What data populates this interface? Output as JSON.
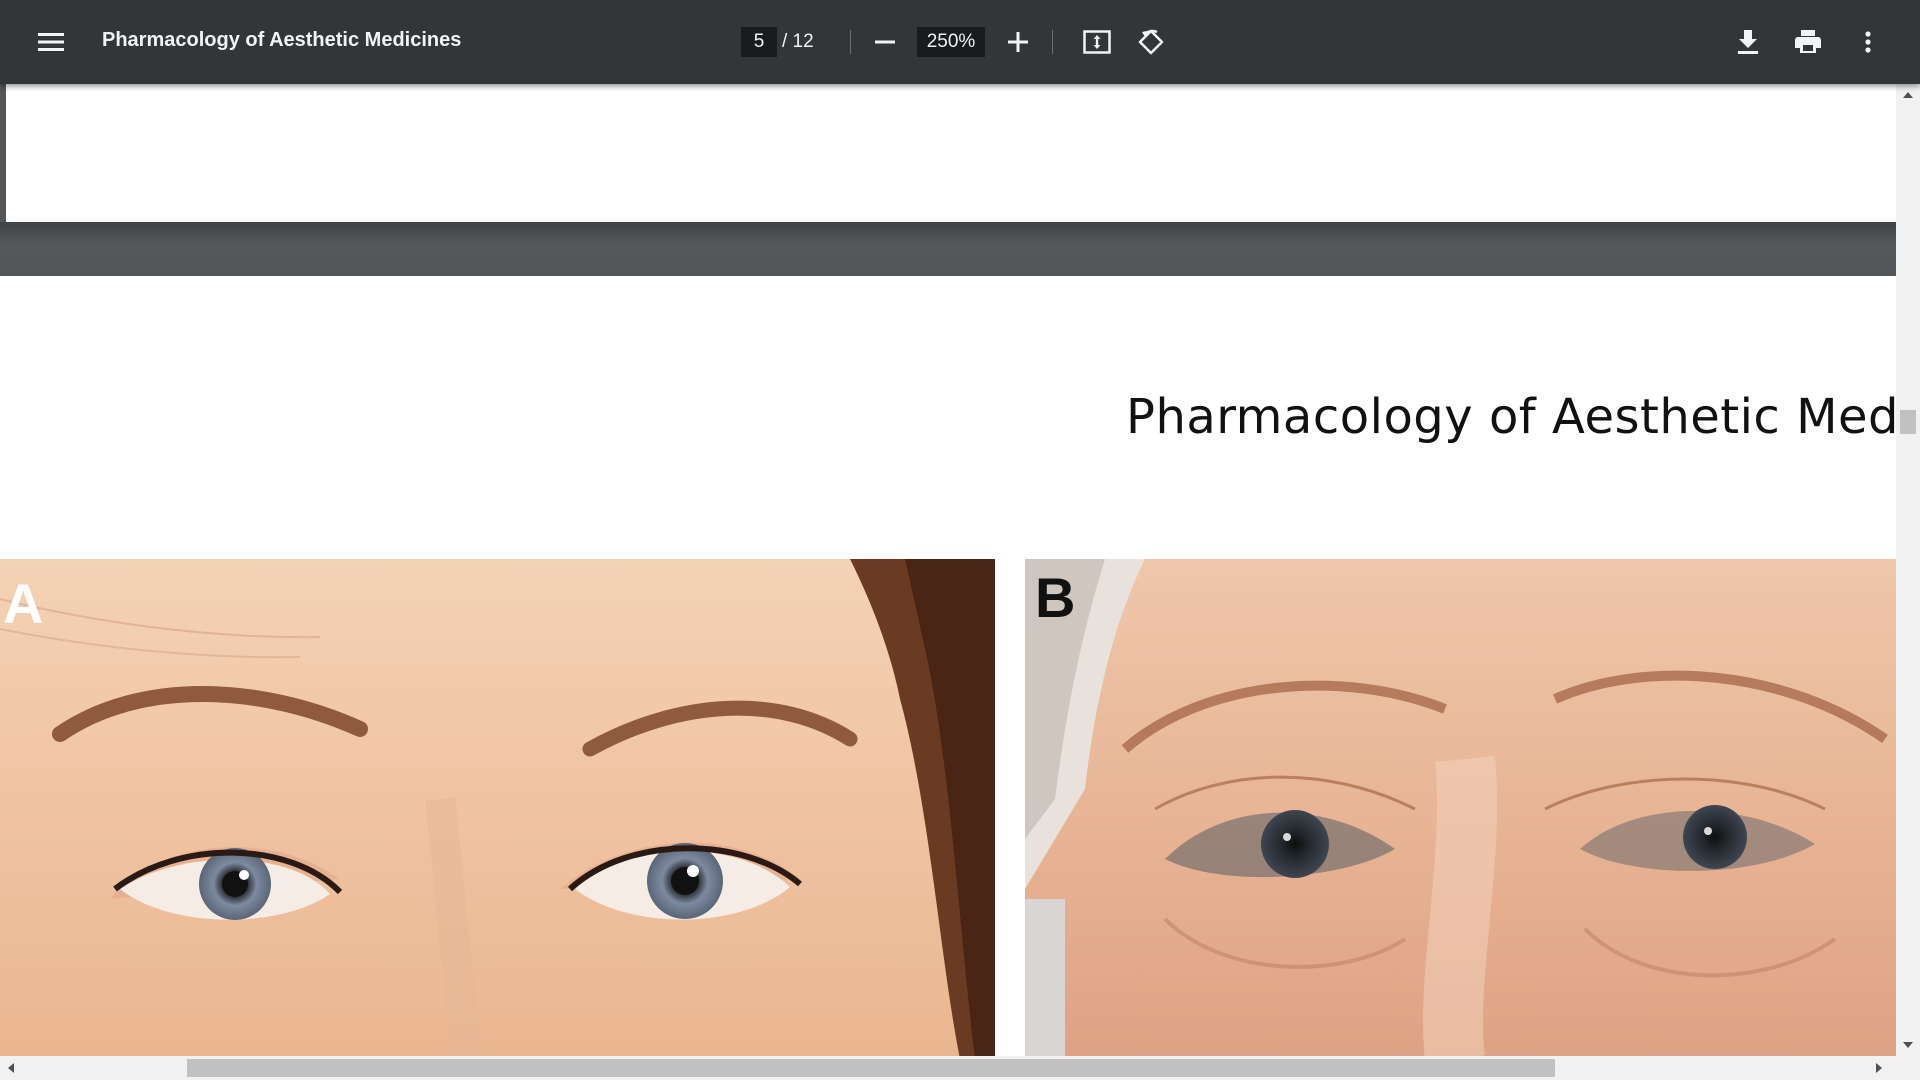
{
  "toolbar": {
    "menu_icon": "hamburger-menu-icon",
    "title": "Pharmacology of Aesthetic Medicines",
    "current_page": "5",
    "page_total": "/ 12",
    "zoom": "250%",
    "zoom_out_icon": "minus-icon",
    "zoom_in_icon": "plus-icon",
    "fit_icon": "fit-to-page-icon",
    "rotate_icon": "rotate-counterclockwise-icon",
    "download_icon": "download-icon",
    "print_icon": "print-icon",
    "more_icon": "more-vert-icon"
  },
  "document": {
    "running_head": "Pharmacology of Aesthetic Medicir",
    "figure_panels": [
      {
        "label": "A"
      },
      {
        "label": "B"
      }
    ]
  },
  "colors": {
    "toolbar_bg": "#323639",
    "viewer_bg": "#525659",
    "input_bg": "#191b1c",
    "page_bg": "#ffffff"
  }
}
